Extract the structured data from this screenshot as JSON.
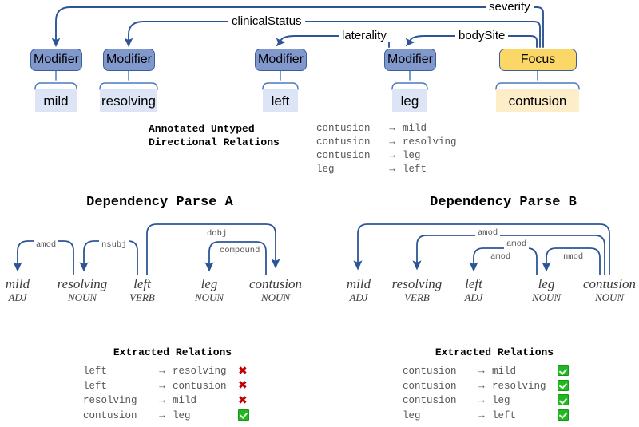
{
  "schema": {
    "nodes": [
      {
        "type": "Modifier",
        "label": "Modifier",
        "token": "mild"
      },
      {
        "type": "Modifier",
        "label": "Modifier",
        "token": "resolving"
      },
      {
        "type": "Modifier",
        "label": "Modifier",
        "token": "left"
      },
      {
        "type": "Modifier",
        "label": "Modifier",
        "token": "leg"
      },
      {
        "type": "Focus",
        "label": "Focus",
        "token": "contusion"
      }
    ],
    "edges": [
      {
        "label": "severity",
        "from": "Focus",
        "to": "Modifier(mild)"
      },
      {
        "label": "clinicalStatus",
        "from": "Focus",
        "to": "Modifier(resolving)"
      },
      {
        "label": "laterality",
        "from": "Modifier(leg)",
        "to": "Modifier(left)"
      },
      {
        "label": "bodySite",
        "from": "Focus",
        "to": "Modifier(leg)"
      }
    ],
    "colors": {
      "modifier_fill": "#8098cc",
      "focus_fill": "#fad766",
      "node_border": "#3a5f9e",
      "modifier_token_fill": "#dce4f5",
      "focus_token_fill": "#fdeec9",
      "arrow": "#2d5596"
    }
  },
  "annotated": {
    "title_line1": "Annotated Untyped",
    "title_line2": "Directional Relations",
    "relations": [
      {
        "source": "contusion",
        "arrow": "→",
        "target": "mild"
      },
      {
        "source": "contusion",
        "arrow": "→",
        "target": "resolving"
      },
      {
        "source": "contusion",
        "arrow": "→",
        "target": "leg"
      },
      {
        "source": "leg",
        "arrow": "→",
        "target": "left"
      }
    ]
  },
  "parse_a": {
    "title": "Dependency Parse A",
    "words": [
      {
        "text": "mild",
        "pos": "ADJ"
      },
      {
        "text": "resolving",
        "pos": "NOUN"
      },
      {
        "text": "left",
        "pos": "VERB"
      },
      {
        "text": "leg",
        "pos": "NOUN"
      },
      {
        "text": "contusion",
        "pos": "NOUN"
      }
    ],
    "arcs": [
      {
        "label": "amod",
        "head": "resolving",
        "dependent": "mild"
      },
      {
        "label": "nsubj",
        "head": "left",
        "dependent": "resolving"
      },
      {
        "label": "dobj",
        "head": "left",
        "dependent": "contusion"
      },
      {
        "label": "compound",
        "head": "contusion",
        "dependent": "leg"
      }
    ],
    "extracted": {
      "title": "Extracted Relations",
      "rows": [
        {
          "source": "left",
          "arrow": "→",
          "target": "resolving",
          "status": "wrong"
        },
        {
          "source": "left",
          "arrow": "→",
          "target": "contusion",
          "status": "wrong"
        },
        {
          "source": "resolving",
          "arrow": "→",
          "target": "mild",
          "status": "wrong"
        },
        {
          "source": "contusion",
          "arrow": "→",
          "target": "leg",
          "status": "correct"
        }
      ]
    }
  },
  "parse_b": {
    "title": "Dependency Parse B",
    "words": [
      {
        "text": "mild",
        "pos": "ADJ"
      },
      {
        "text": "resolving",
        "pos": "VERB"
      },
      {
        "text": "left",
        "pos": "ADJ"
      },
      {
        "text": "leg",
        "pos": "NOUN"
      },
      {
        "text": "contusion",
        "pos": "NOUN"
      }
    ],
    "arcs": [
      {
        "label": "amod",
        "head": "contusion",
        "dependent": "mild"
      },
      {
        "label": "amod",
        "head": "contusion",
        "dependent": "resolving"
      },
      {
        "label": "amod",
        "head": "leg",
        "dependent": "left"
      },
      {
        "label": "nmod",
        "head": "contusion",
        "dependent": "leg"
      }
    ],
    "extracted": {
      "title": "Extracted Relations",
      "rows": [
        {
          "source": "contusion",
          "arrow": "→",
          "target": "mild",
          "status": "correct"
        },
        {
          "source": "contusion",
          "arrow": "→",
          "target": "resolving",
          "status": "correct"
        },
        {
          "source": "contusion",
          "arrow": "→",
          "target": "leg",
          "status": "correct"
        },
        {
          "source": "leg",
          "arrow": "→",
          "target": "left",
          "status": "correct"
        }
      ]
    }
  },
  "marks": {
    "wrong_symbol": "✖",
    "correct_symbol": "✔"
  }
}
